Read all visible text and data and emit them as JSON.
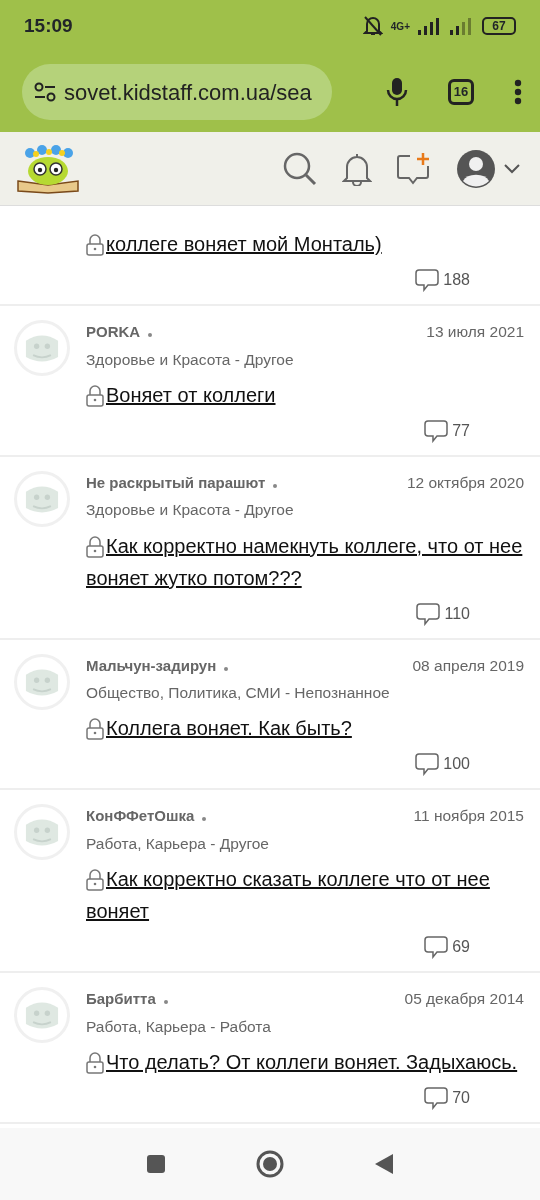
{
  "status_bar": {
    "time": "15:09",
    "network": "4G+",
    "battery": "67"
  },
  "browser": {
    "url": "sovet.kidstaff.com.ua/sea",
    "tab_count": "16"
  },
  "topics": [
    {
      "title": "коллеге воняет мой Монталь)",
      "locked": true,
      "comments": "188"
    },
    {
      "author": "PORKA",
      "date": "13 июля 2021",
      "category": "Здоровье и Красота - Другое",
      "title": "Воняет от коллеги",
      "locked": true,
      "comments": "77"
    },
    {
      "author": "Не раскрытый парашют",
      "date": "12 октября 2020",
      "category": "Здоровье и Красота - Другое",
      "title": "Как корректно намекнуть коллеге, что от нее воняет жутко потом???",
      "locked": true,
      "comments": "110"
    },
    {
      "author": "Мальчун-задирун",
      "date": "08 апреля 2019",
      "category": "Общество, Политика, СМИ - Непознанное",
      "title": "Коллега воняет. Как быть?",
      "locked": true,
      "comments": "100"
    },
    {
      "author": "КонФФетОшка",
      "date": "11 ноября 2015",
      "category": "Работа, Карьера - Другое",
      "title": "Как корректно сказать коллеге что от нее воняет",
      "locked": true,
      "comments": "69"
    },
    {
      "author": "Барбитта",
      "date": "05 декабря 2014",
      "category": "Работа, Карьера - Работа",
      "title": "Что делать? От коллеги воняет. Задыхаюсь.",
      "locked": true,
      "comments": "70"
    }
  ]
}
